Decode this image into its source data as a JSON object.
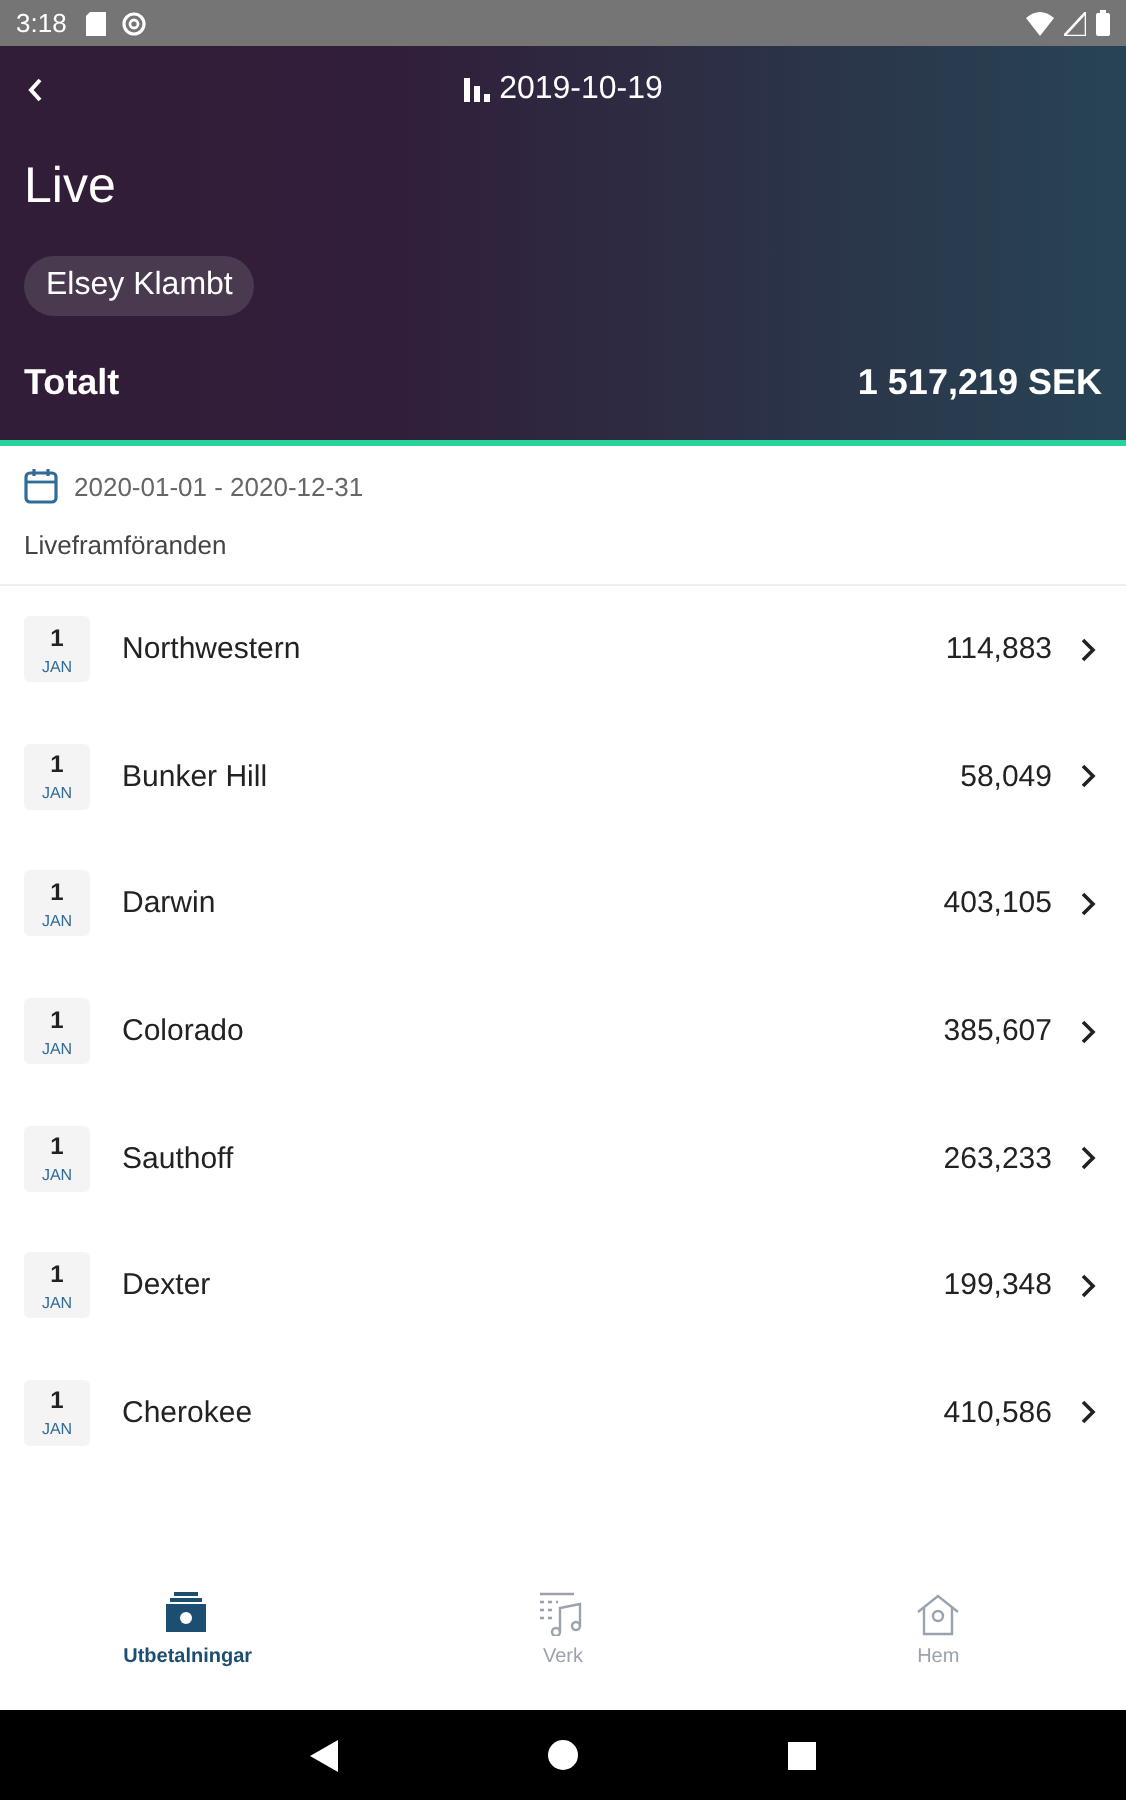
{
  "status_bar": {
    "time": "3:18"
  },
  "header": {
    "title": "2019-10-19",
    "heading": "Live",
    "chip": "Elsey Klambt",
    "total_label": "Totalt",
    "total_value": "1 517,219 SEK"
  },
  "period": "2020-01-01 - 2020-12-31",
  "section_title": "Liveframföranden",
  "rows": [
    {
      "day": "1",
      "month": "JAN",
      "name": "Northwestern",
      "amount": "114,883"
    },
    {
      "day": "1",
      "month": "JAN",
      "name": "Bunker Hill",
      "amount": "58,049"
    },
    {
      "day": "1",
      "month": "JAN",
      "name": "Darwin",
      "amount": "403,105"
    },
    {
      "day": "1",
      "month": "JAN",
      "name": "Colorado",
      "amount": "385,607"
    },
    {
      "day": "1",
      "month": "JAN",
      "name": "Sauthoff",
      "amount": "263,233"
    },
    {
      "day": "1",
      "month": "JAN",
      "name": "Dexter",
      "amount": "199,348"
    },
    {
      "day": "1",
      "month": "JAN",
      "name": "Cherokee",
      "amount": "410,586"
    }
  ],
  "tabs": [
    {
      "kind": "payments",
      "label": "Utbetalningar",
      "selected": true
    },
    {
      "kind": "works",
      "label": "Verk",
      "selected": false
    },
    {
      "kind": "home",
      "label": "Hem",
      "selected": false
    }
  ]
}
